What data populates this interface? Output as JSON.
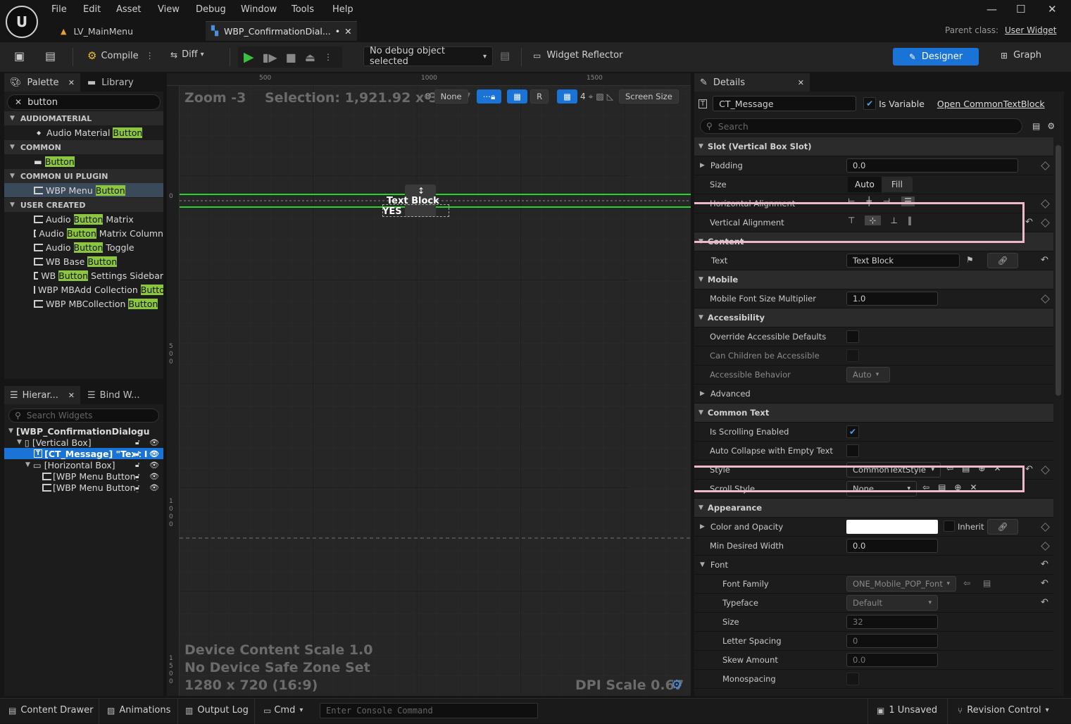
{
  "menu": [
    "File",
    "Edit",
    "Asset",
    "View",
    "Debug",
    "Window",
    "Tools",
    "Help"
  ],
  "tabs": {
    "level": "LV_MainMenu",
    "widget": "WBP_ConfirmationDial...",
    "widget_modified": "•"
  },
  "parent": {
    "label": "Parent class:",
    "value": "User Widget"
  },
  "toolbar": {
    "compile": "Compile",
    "diff": "Diff",
    "debug_object": "No debug object selected",
    "widget_reflector": "Widget Reflector",
    "designer": "Designer",
    "graph": "Graph"
  },
  "palette": {
    "tab": "Palette",
    "library_tab": "Library",
    "search_value": "button",
    "categories": [
      {
        "name": "AUDIOMATERIAL",
        "items": [
          {
            "pre": "Audio Material ",
            "hl": "Button",
            "post": ""
          }
        ]
      },
      {
        "name": "COMMON",
        "items": [
          {
            "pre": "",
            "hl": "Button",
            "post": ""
          }
        ]
      },
      {
        "name": "COMMON UI PLUGIN",
        "items": [
          {
            "pre": "WBP Menu ",
            "hl": "Button",
            "post": ""
          }
        ]
      },
      {
        "name": "USER CREATED",
        "items": [
          {
            "pre": "Audio ",
            "hl": "Button",
            "post": " Matrix"
          },
          {
            "pre": "Audio ",
            "hl": "Button",
            "post": " Matrix Column"
          },
          {
            "pre": "Audio ",
            "hl": "Button",
            "post": " Toggle"
          },
          {
            "pre": "WB Base ",
            "hl": "Button",
            "post": ""
          },
          {
            "pre": "WB ",
            "hl": "Button",
            "post": " Settings Sidebar"
          },
          {
            "pre": "WBP MBAdd Collection ",
            "hl": "Butto",
            "post": ""
          },
          {
            "pre": "WBP MBCollection ",
            "hl": "Button",
            "post": ""
          }
        ]
      }
    ]
  },
  "hierarchy": {
    "tab": "Hierar...",
    "bind_tab": "Bind W...",
    "search_placeholder": "Search Widgets",
    "nodes": [
      {
        "label": "[WBP_ConfirmationDialogu",
        "depth": 0
      },
      {
        "label": "[Vertical Box]",
        "depth": 1
      },
      {
        "label": "[CT_Message] \"Text I",
        "depth": 2
      },
      {
        "label": "[Horizontal Box]",
        "depth": 2
      },
      {
        "label": "[WBP Menu Button]",
        "depth": 3
      },
      {
        "label": "[WBP Menu Button]",
        "depth": 3
      }
    ]
  },
  "viewport": {
    "zoom": "Zoom -3",
    "selection": "Selection: 1,921.92 x 33.37",
    "none_label": "None",
    "r_label": "R",
    "grid_num": "4",
    "screen_size": "Screen Size",
    "ruler_top": [
      "500",
      "1000",
      "1500"
    ],
    "ruler_left": [
      "0",
      "5\n0\n0",
      "1\n0\n0\n0",
      "1\n5\n0\n0"
    ],
    "text_block": "Text Block",
    "yes": "YES",
    "device_scale": "Device Content Scale 1.0",
    "safe_zone": "No Device Safe Zone Set",
    "resolution": "1280 x 720 (16:9)",
    "dpi": "DPI Scale 0.67"
  },
  "details": {
    "tab": "Details",
    "name_value": "CT_Message",
    "is_variable": "Is Variable",
    "open_link": "Open CommonTextBlock",
    "search_placeholder": "Search",
    "slot_section": "Slot (Vertical Box Slot)",
    "padding": {
      "label": "Padding",
      "value": "0.0"
    },
    "size": {
      "label": "Size",
      "auto": "Auto",
      "fill": "Fill"
    },
    "halign": "Horizontal Alignment",
    "valign": "Vertical Alignment",
    "content_section": "Content",
    "text": {
      "label": "Text",
      "value": "Text Block"
    },
    "mobile_section": "Mobile",
    "mobile_mult": {
      "label": "Mobile Font Size Multiplier",
      "value": "1.0"
    },
    "access_section": "Accessibility",
    "override_access": "Override Accessible Defaults",
    "children_access": "Can Children be Accessible",
    "access_behavior": {
      "label": "Accessible Behavior",
      "value": "Auto"
    },
    "advanced": "Advanced",
    "commontext_section": "Common Text",
    "scrolling": "Is Scrolling Enabled",
    "autocollapse": "Auto Collapse with Empty Text",
    "style": {
      "label": "Style",
      "value": "CommonTextStyle"
    },
    "scroll_style": {
      "label": "Scroll Style",
      "value": "None"
    },
    "appearance_section": "Appearance",
    "color_opacity": {
      "label": "Color and Opacity",
      "inherit": "Inherit"
    },
    "min_width": {
      "label": "Min Desired Width",
      "value": "0.0"
    },
    "font": "Font",
    "font_family": {
      "label": "Font Family",
      "value": "ONE_Mobile_POP_Font"
    },
    "typeface": {
      "label": "Typeface",
      "value": "Default"
    },
    "fsize": {
      "label": "Size",
      "value": "32"
    },
    "letter_spacing": {
      "label": "Letter Spacing",
      "value": "0"
    },
    "skew": {
      "label": "Skew Amount",
      "value": "0.0"
    },
    "monospacing": "Monospacing"
  },
  "status": {
    "content_drawer": "Content Drawer",
    "animations": "Animations",
    "output_log": "Output Log",
    "cmd": "Cmd",
    "console_placeholder": "Enter Console Command",
    "unsaved": "1 Unsaved",
    "revision": "Revision Control"
  },
  "colors": {
    "accent": "#1a74d8",
    "highlight": "#8cc63f",
    "selection_line": "#27d427",
    "pink_box": "#f0b8cc"
  }
}
